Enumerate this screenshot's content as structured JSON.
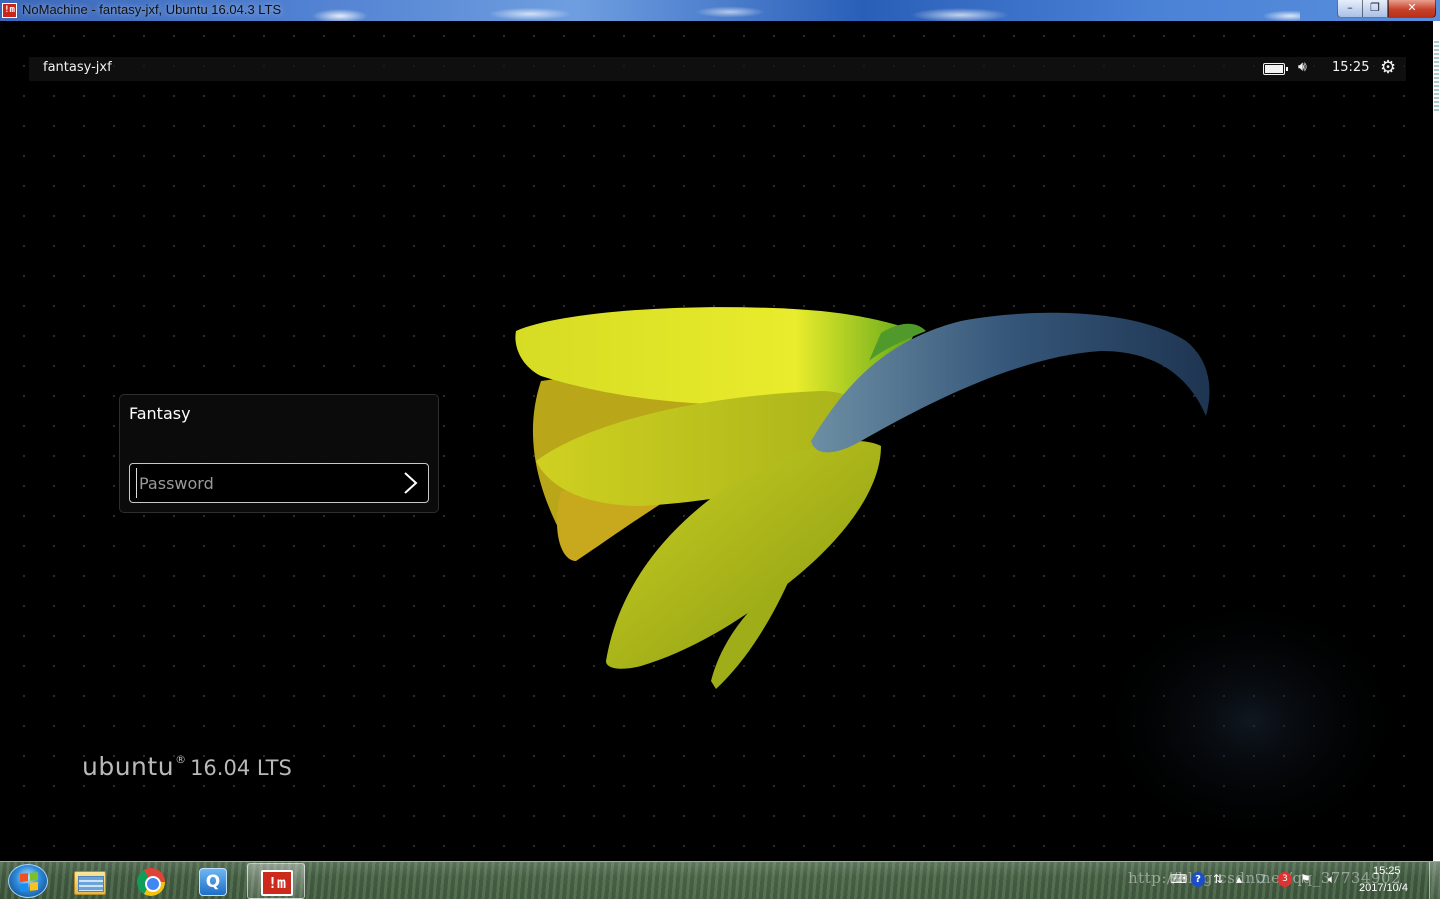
{
  "window": {
    "title": "NoMachine - fantasy-jxf, Ubuntu 16.04.3 LTS",
    "app_icon_text": "!m",
    "minimize_label": "–",
    "maximize_label": "❐",
    "close_label": "✕"
  },
  "panel": {
    "hostname": "fantasy-jxf",
    "clock": "15:25",
    "icons": [
      "battery-icon",
      "volume-icon",
      "gear-icon"
    ],
    "volume_glyph": "🔊︎",
    "gear_glyph": "⚙"
  },
  "login": {
    "username": "Fantasy",
    "password_placeholder": "Password",
    "password_value": ""
  },
  "branding": {
    "brand": "ubuntu",
    "reg_mark": "®",
    "version": "16.04 LTS"
  },
  "taskbar": {
    "apps": [
      {
        "name": "windows-explorer",
        "active": false
      },
      {
        "name": "chrome",
        "active": false
      },
      {
        "name": "qq",
        "active": false,
        "glyph": "Q"
      },
      {
        "name": "nomachine",
        "active": true,
        "glyph": "!m"
      }
    ],
    "tray": {
      "watermark": "http://blog.csdn.net/qq_37734902",
      "help_glyph": "?",
      "badge_glyph": "3",
      "time": "15:25",
      "date": "2017/10/4"
    }
  },
  "colors": {
    "title_bar": "#3b67b8",
    "close_button": "#c7422a",
    "nomachine_red": "#cc2a1d",
    "flower_yellow": "#e3e62a",
    "bud_blue": "#3f5f8a"
  }
}
